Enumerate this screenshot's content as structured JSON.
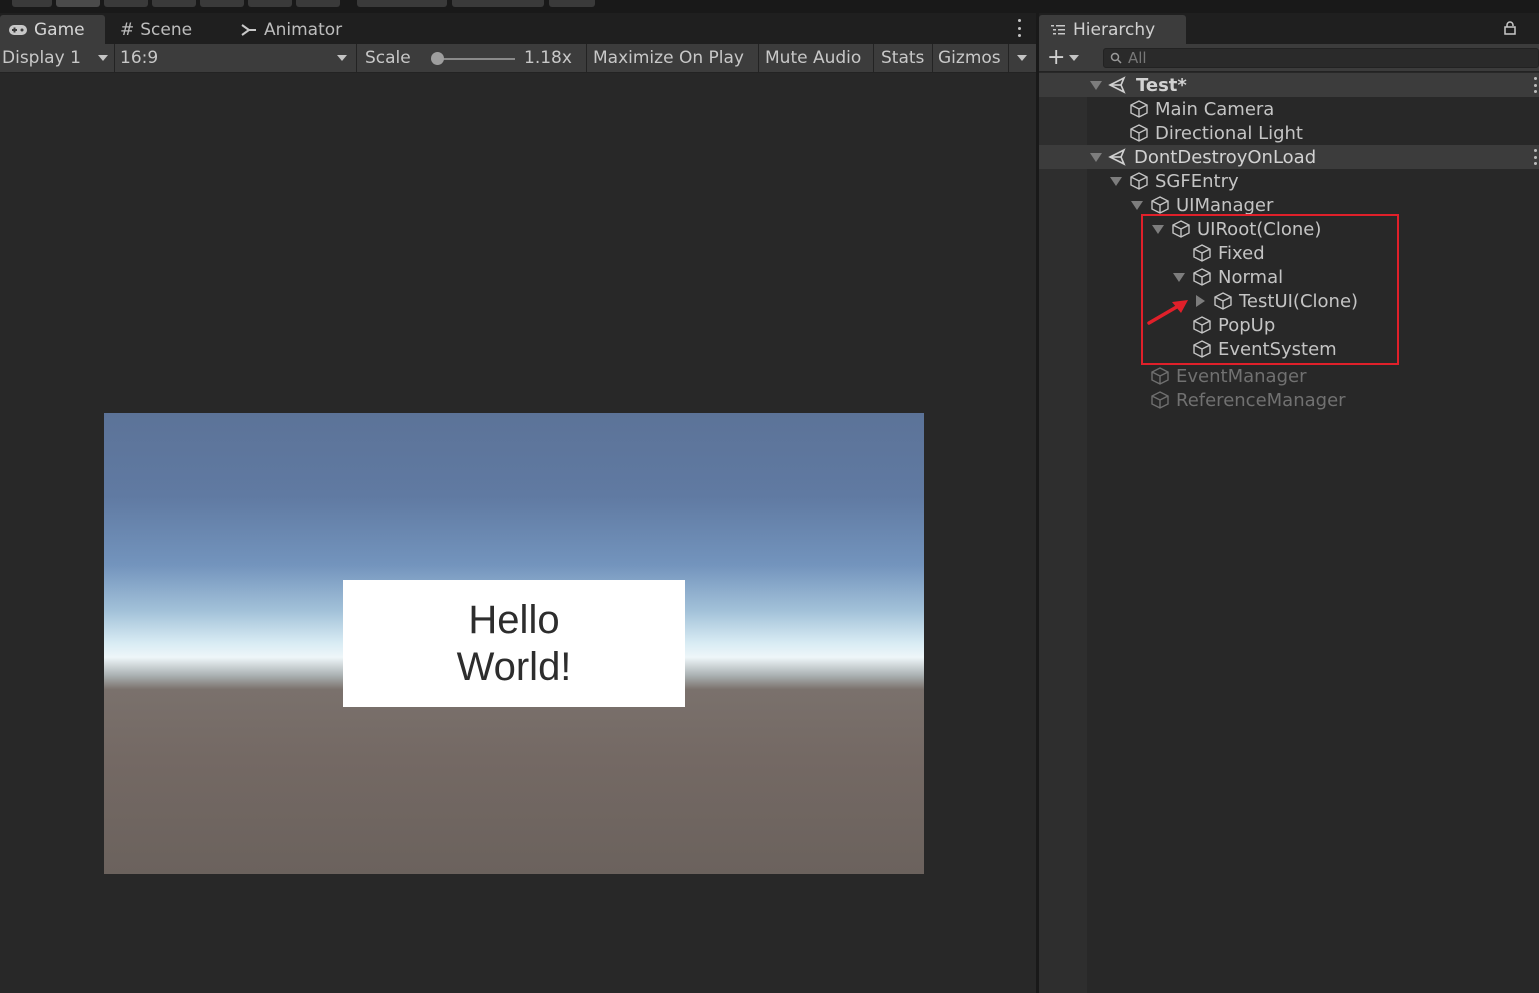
{
  "game_panel": {
    "tabs": [
      {
        "label": "Game",
        "icon": "gamepad-icon",
        "active": true
      },
      {
        "label": "Scene",
        "icon": "grid-icon",
        "active": false
      },
      {
        "label": "Animator",
        "icon": "animator-icon",
        "active": false
      }
    ],
    "controls": {
      "display": "Display 1",
      "aspect": "16:9",
      "scale_label": "Scale",
      "scale_value": "1.18x",
      "scale_fraction": 0.05,
      "maximize_on_play": "Maximize On Play",
      "mute_audio": "Mute Audio",
      "stats": "Stats",
      "gizmos": "Gizmos"
    },
    "viewport": {
      "hello_text": "Hello\nWorld!"
    }
  },
  "hierarchy": {
    "title": "Hierarchy",
    "search_placeholder": "All",
    "rows": [
      {
        "label": "Test*",
        "type": "scene",
        "expanded": true
      },
      {
        "label": "Main Camera",
        "type": "object"
      },
      {
        "label": "Directional Light",
        "type": "object"
      },
      {
        "label": "DontDestroyOnLoad",
        "type": "scene",
        "expanded": true
      },
      {
        "label": "SGFEntry",
        "type": "object",
        "expanded": true
      },
      {
        "label": "UIManager",
        "type": "object",
        "expanded": true
      },
      {
        "label": "UIRoot(Clone)",
        "type": "object",
        "expanded": true
      },
      {
        "label": "Fixed",
        "type": "object"
      },
      {
        "label": "Normal",
        "type": "object",
        "expanded": true
      },
      {
        "label": "TestUI(Clone)",
        "type": "object",
        "expanded": false
      },
      {
        "label": "PopUp",
        "type": "object"
      },
      {
        "label": "EventSystem",
        "type": "object"
      },
      {
        "label": "EventManager",
        "type": "object",
        "inactive": true
      },
      {
        "label": "ReferenceManager",
        "type": "object",
        "inactive": true
      }
    ]
  },
  "colors": {
    "annotation": "#e0202a",
    "panel_bg": "#282828",
    "toolbar_bg": "#3c3c3c"
  }
}
